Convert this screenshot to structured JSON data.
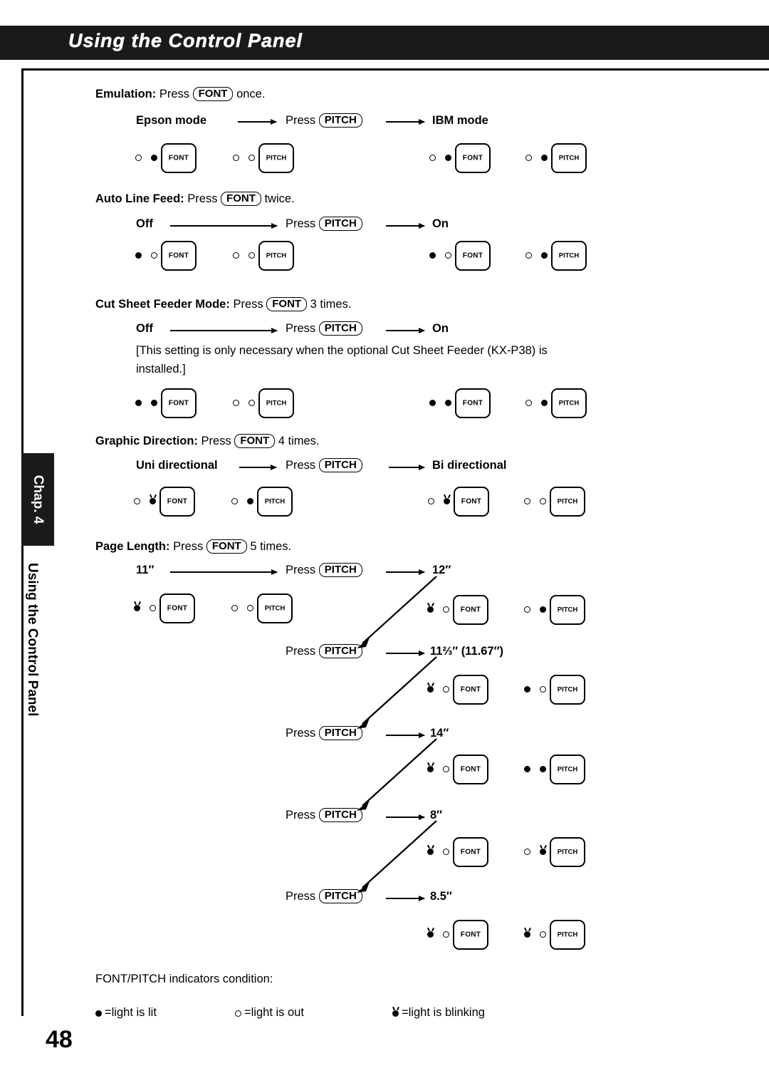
{
  "header": {
    "title": "Using the Control Panel"
  },
  "side": {
    "chapter": "Chap. 4",
    "vertical_title": "Using the Control Panel"
  },
  "page": {
    "number": "48"
  },
  "keys": {
    "font": "FONT",
    "pitch": "PITCH"
  },
  "sections": [
    {
      "name": "emulation",
      "heading_label": "Emulation",
      "heading_sep": ":",
      "heading_press": "Press",
      "heading_key": "FONT",
      "heading_suffix": "once.",
      "left_state": "Epson mode",
      "mid_press": "Press",
      "mid_key": "PITCH",
      "right_state": "IBM mode"
    },
    {
      "name": "auto-line-feed",
      "heading_label": "Auto Line Feed",
      "heading_sep": ":",
      "heading_press": "Press",
      "heading_key": "FONT",
      "heading_suffix": "twice.",
      "left_state": "Off",
      "mid_press": "Press",
      "mid_key": "PITCH",
      "right_state": "On"
    },
    {
      "name": "cut-sheet-feeder-mode",
      "heading_label": "Cut Sheet Feeder Mode",
      "heading_sep": ":",
      "heading_press": "Press",
      "heading_key": "FONT",
      "heading_suffix": "3 times.",
      "left_state": "Off",
      "mid_press": "Press",
      "mid_key": "PITCH",
      "right_state": "On",
      "note_line1": "[This setting is only necessary when the optional Cut Sheet Feeder (KX-P38) is",
      "note_line2": "installed.]"
    },
    {
      "name": "graphic-direction",
      "heading_label": "Graphic Direction",
      "heading_sep": ":",
      "heading_press": "Press",
      "heading_key": "FONT",
      "heading_suffix": "4 times.",
      "left_state": "Uni directional",
      "mid_press": "Press",
      "mid_key": "PITCH",
      "right_state": "Bi directional"
    },
    {
      "name": "page-length",
      "heading_label": "Page Length",
      "heading_sep": ":",
      "heading_press": "Press",
      "heading_key": "FONT",
      "heading_suffix": "5 times.",
      "left_state": "11″",
      "mid_press": "Press",
      "mid_key": "PITCH",
      "right_state": "12″",
      "steps": [
        {
          "press": "Press",
          "key": "PITCH",
          "value": "11⅔″ (11.67″)"
        },
        {
          "press": "Press",
          "key": "PITCH",
          "value": "14″"
        },
        {
          "press": "Press",
          "key": "PITCH",
          "value": "8″"
        },
        {
          "press": "Press",
          "key": "PITCH",
          "value": "8.5″"
        }
      ]
    }
  ],
  "panel_rows": [
    {
      "id": "emulation",
      "left_font": [
        "out",
        "lit"
      ],
      "left_pitch": [
        "out",
        "out"
      ],
      "right_font": [
        "out",
        "lit"
      ],
      "right_pitch": [
        "out",
        "lit"
      ]
    },
    {
      "id": "auto-line-feed",
      "left_font": [
        "lit",
        "out"
      ],
      "left_pitch": [
        "out",
        "out"
      ],
      "right_font": [
        "lit",
        "out"
      ],
      "right_pitch": [
        "out",
        "lit"
      ]
    },
    {
      "id": "cut-sheet-feeder",
      "left_font": [
        "lit",
        "lit"
      ],
      "left_pitch": [
        "out",
        "out"
      ],
      "right_font": [
        "lit",
        "lit"
      ],
      "right_pitch": [
        "out",
        "lit"
      ]
    },
    {
      "id": "graphic-direction",
      "left_font": [
        "out",
        "blink"
      ],
      "left_pitch": [
        "out",
        "lit"
      ],
      "right_font": [
        "out",
        "blink"
      ],
      "right_pitch": [
        "out",
        "out"
      ]
    },
    {
      "id": "page-length-11",
      "left_font": [
        "blink",
        "out"
      ],
      "left_pitch": [
        "out",
        "out"
      ],
      "right_font": [
        "blink",
        "out"
      ],
      "right_pitch": [
        "out",
        "lit"
      ]
    },
    {
      "id": "page-length-11-67",
      "right_font": [
        "blink",
        "out"
      ],
      "right_pitch": [
        "lit",
        "out"
      ]
    },
    {
      "id": "page-length-14",
      "right_font": [
        "blink",
        "out"
      ],
      "right_pitch": [
        "lit",
        "lit"
      ]
    },
    {
      "id": "page-length-8",
      "right_font": [
        "blink",
        "out"
      ],
      "right_pitch": [
        "out",
        "blink"
      ]
    },
    {
      "id": "page-length-8-5",
      "right_font": [
        "blink",
        "out"
      ],
      "right_pitch": [
        "blink",
        "out"
      ]
    }
  ],
  "legend": {
    "title": "FONT/PITCH indicators condition:",
    "lit_text": "=light is lit",
    "out_text": "=light is out",
    "blink_text": "=light is blinking"
  },
  "labels": {
    "font_button": "FONT",
    "pitch_button": "PITCH"
  }
}
